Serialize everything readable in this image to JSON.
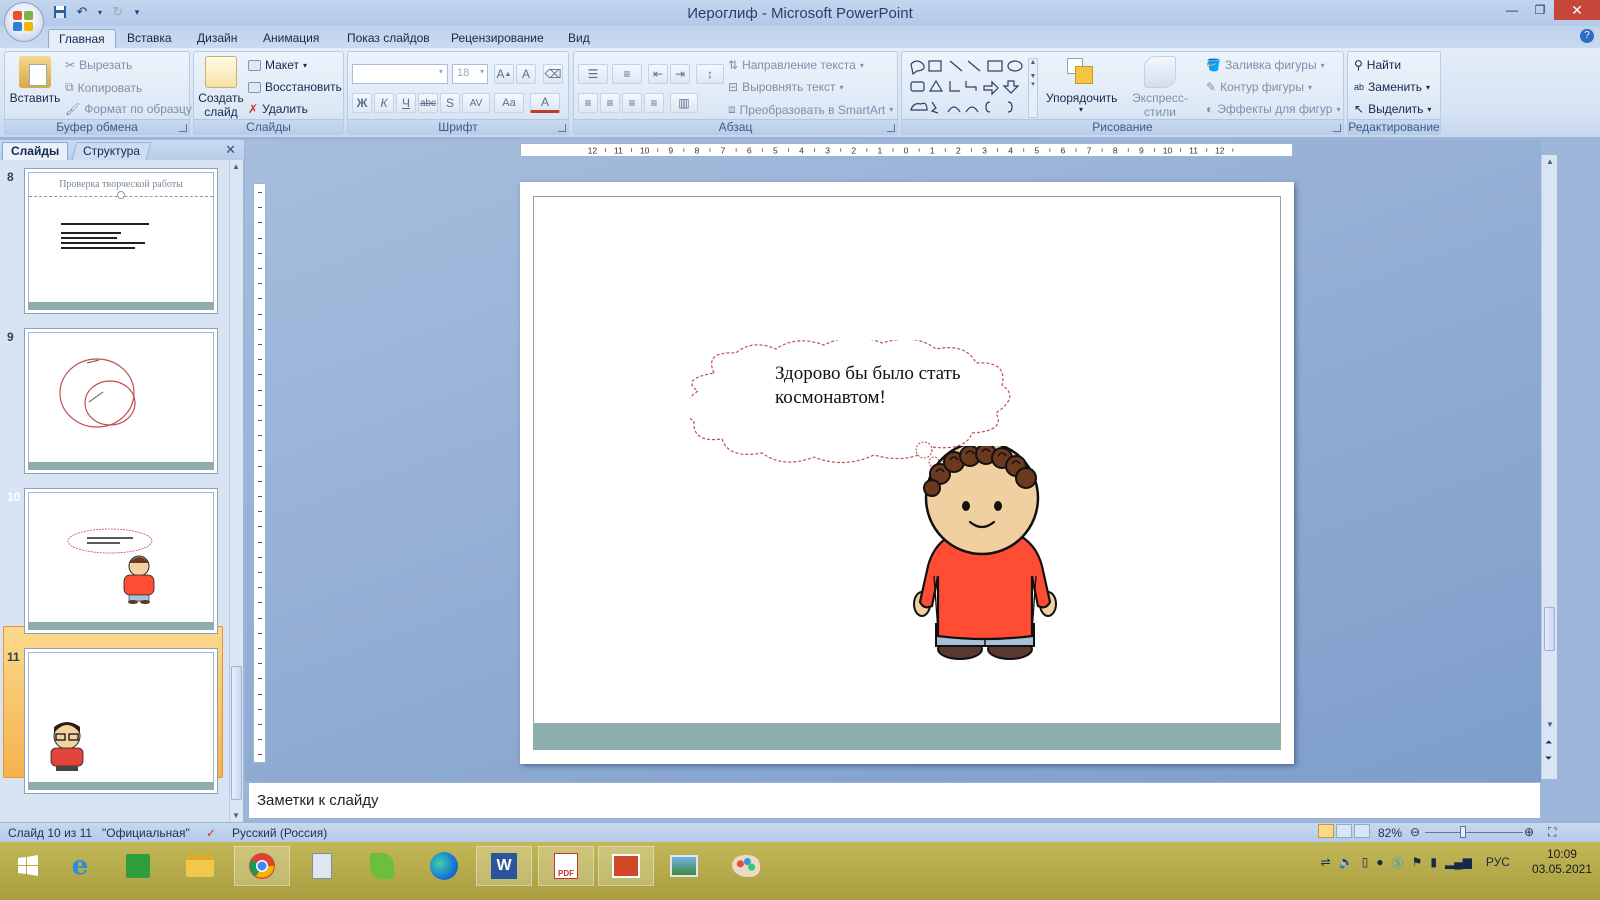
{
  "window": {
    "title": "Иероглиф - Microsoft PowerPoint"
  },
  "tabs": [
    "Главная",
    "Вставка",
    "Дизайн",
    "Анимация",
    "Показ слайдов",
    "Рецензирование",
    "Вид"
  ],
  "ribbon": {
    "clipboard": {
      "label": "Буфер обмена",
      "paste": "Вставить",
      "cut": "Вырезать",
      "copy": "Копировать",
      "format_painter": "Формат по образцу"
    },
    "slides": {
      "label": "Слайды",
      "new_slide_line1": "Создать",
      "new_slide_line2": "слайд",
      "layout": "Макет",
      "reset": "Восстановить",
      "delete": "Удалить"
    },
    "font": {
      "label": "Шрифт",
      "size": "18"
    },
    "paragraph": {
      "label": "Абзац",
      "text_direction": "Направление текста",
      "align_text": "Выровнять текст",
      "convert_smartart": "Преобразовать в SmartArt"
    },
    "drawing": {
      "label": "Рисование",
      "arrange": "Упорядочить",
      "quick_styles": "Экспресс-стили",
      "shape_fill": "Заливка фигуры",
      "shape_outline": "Контур фигуры",
      "shape_effects": "Эффекты для фигур"
    },
    "editing": {
      "label": "Редактирование",
      "find": "Найти",
      "replace": "Заменить",
      "select": "Выделить"
    }
  },
  "panel": {
    "tab_slides": "Слайды",
    "tab_outline": "Структура",
    "thumbs": [
      {
        "num": "8",
        "title": "Проверка творческой работы"
      },
      {
        "num": "9"
      },
      {
        "num": "10"
      },
      {
        "num": "11"
      }
    ]
  },
  "slide": {
    "bubble_text": "Здорово бы было стать космонавтом!"
  },
  "notes": {
    "placeholder": "Заметки к слайду"
  },
  "status": {
    "slide_counter": "Слайд 10 из 11",
    "theme": "\"Официальная\"",
    "language": "Русский (Россия)",
    "zoom": "82%"
  },
  "taskbar": {
    "lang": "РУС",
    "time": "10:09",
    "date": "03.05.2021"
  },
  "colors": {
    "accent": "#2b579a",
    "slide_footer": "#8eadad",
    "shirt": "#ff4d33",
    "bubble_outline": "#c0504d"
  }
}
